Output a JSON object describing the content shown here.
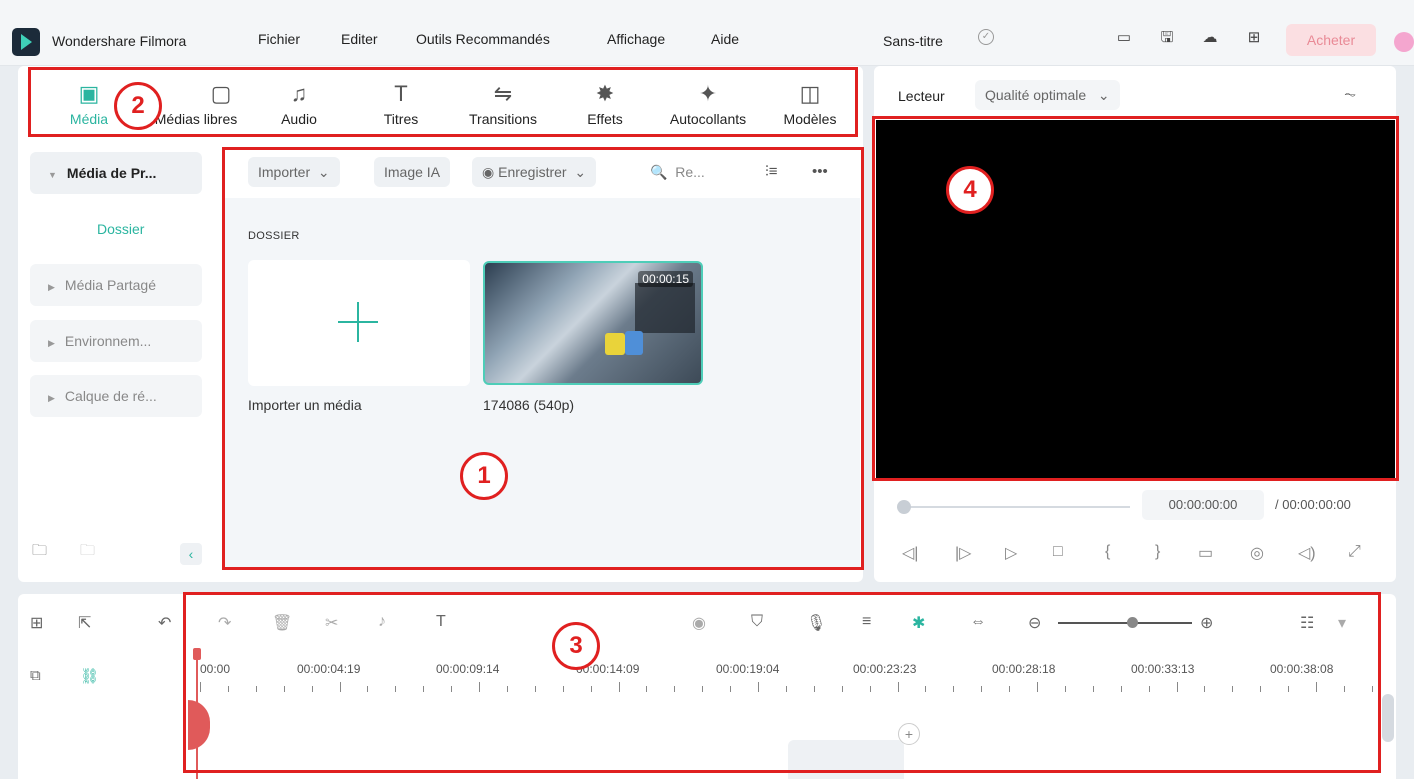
{
  "app": {
    "name": "Wondershare Filmora",
    "menu": [
      "Fichier",
      "Editer",
      "Outils Recommandés",
      "Affichage",
      "Aide"
    ],
    "doc_title": "Sans-titre",
    "buy_label": "Acheter"
  },
  "tabs": [
    {
      "label": "Média",
      "icon": "media-icon"
    },
    {
      "label": "Médias libres",
      "icon": "stock-media-icon"
    },
    {
      "label": "Audio",
      "icon": "music-note-icon"
    },
    {
      "label": "Titres",
      "icon": "text-t-icon"
    },
    {
      "label": "Transitions",
      "icon": "transition-icon"
    },
    {
      "label": "Effets",
      "icon": "sparkle-icon"
    },
    {
      "label": "Autocollants",
      "icon": "sticker-icon"
    },
    {
      "label": "Modèles",
      "icon": "template-icon"
    }
  ],
  "sidebar": {
    "items": [
      {
        "label": "Média de Pr..."
      },
      {
        "label": "Média Partagé"
      },
      {
        "label": "Environnem..."
      },
      {
        "label": "Calque de ré..."
      }
    ],
    "folder": "Dossier"
  },
  "media": {
    "import_label": "Importer",
    "ai_image_label": "Image IA",
    "record_label": "Enregistrer",
    "search_placeholder": "Re...",
    "section_header": "DOSSIER",
    "import_card_label": "Importer un média",
    "clip": {
      "name": "174086 (540p)",
      "duration": "00:00:15"
    }
  },
  "player": {
    "label": "Lecteur",
    "quality": "Qualité optimale",
    "current_time": "00:00:00:00",
    "total_time": "/ 00:00:00:00"
  },
  "timeline": {
    "ruler": [
      "00:00",
      "00:00:04:19",
      "00:00:09:14",
      "00:00:14:09",
      "00:00:19:04",
      "00:00:23:23",
      "00:00:28:18",
      "00:00:33:13",
      "00:00:38:08"
    ]
  },
  "annotations": {
    "n1": "1",
    "n2": "2",
    "n3": "3",
    "n4": "4"
  },
  "colors": {
    "accent": "#2bb5a0",
    "annotation": "#e02020",
    "buy_bg": "#fbdfe2"
  }
}
